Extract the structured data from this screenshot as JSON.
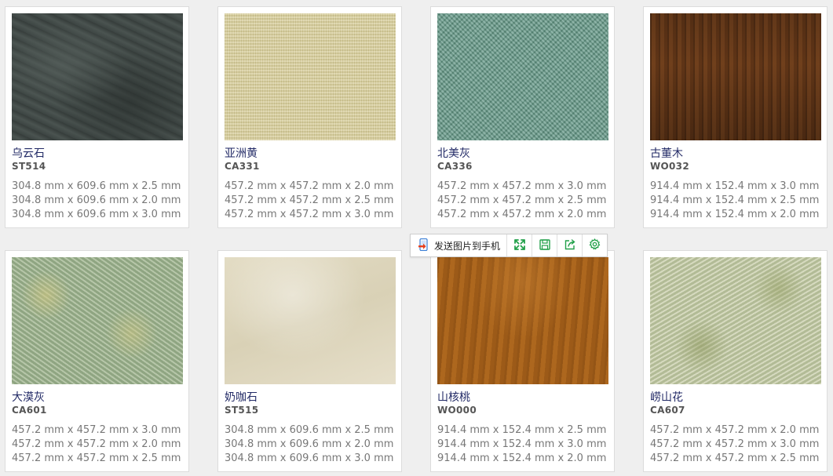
{
  "products": [
    {
      "name": "乌云石",
      "code": "ST514",
      "specs": [
        "304.8 mm x 609.6 mm x 2.5 mm",
        "304.8 mm x 609.6 mm x 2.0 mm",
        "304.8 mm x 609.6 mm x 3.0 mm"
      ]
    },
    {
      "name": "亚洲黄",
      "code": "CA331",
      "specs": [
        "457.2 mm x 457.2 mm x 2.0 mm",
        "457.2 mm x 457.2 mm x 2.5 mm",
        "457.2 mm x 457.2 mm x 3.0 mm"
      ]
    },
    {
      "name": "北美灰",
      "code": "CA336",
      "specs": [
        "457.2 mm x 457.2 mm x 3.0 mm",
        "457.2 mm x 457.2 mm x 2.5 mm",
        "457.2 mm x 457.2 mm x 2.0 mm"
      ]
    },
    {
      "name": "古董木",
      "code": "WO032",
      "specs": [
        "914.4 mm x 152.4 mm x 3.0 mm",
        "914.4 mm x 152.4 mm x 2.5 mm",
        "914.4 mm x 152.4 mm x 2.0 mm"
      ]
    },
    {
      "name": "大漠灰",
      "code": "CA601",
      "specs": [
        "457.2 mm x 457.2 mm x 3.0 mm",
        "457.2 mm x 457.2 mm x 2.0 mm",
        "457.2 mm x 457.2 mm x 2.5 mm"
      ]
    },
    {
      "name": "奶咖石",
      "code": "ST515",
      "specs": [
        "304.8 mm x 609.6 mm x 2.5 mm",
        "304.8 mm x 609.6 mm x 2.0 mm",
        "304.8 mm x 609.6 mm x 3.0 mm"
      ]
    },
    {
      "name": "山核桃",
      "code": "WO000",
      "specs": [
        "914.4 mm x 152.4 mm x 2.5 mm",
        "914.4 mm x 152.4 mm x 3.0 mm",
        "914.4 mm x 152.4 mm x 2.0 mm"
      ]
    },
    {
      "name": "崂山花",
      "code": "CA607",
      "specs": [
        "457.2 mm x 457.2 mm x 2.0 mm",
        "457.2 mm x 457.2 mm x 3.0 mm",
        "457.2 mm x 457.2 mm x 2.5 mm"
      ]
    }
  ],
  "toolbar": {
    "send_label": "发送图片到手机",
    "icons": [
      "phone-send-icon",
      "expand-icon",
      "save-icon",
      "share-icon",
      "settings-icon"
    ],
    "icon_color": "#22a04a"
  }
}
